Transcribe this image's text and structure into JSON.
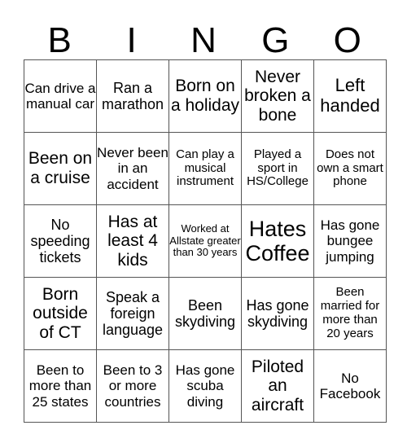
{
  "header": {
    "letters": [
      "B",
      "I",
      "N",
      "G",
      "O"
    ]
  },
  "rows": [
    [
      "Can drive a manual car",
      "Ran a marathon",
      "Born on a holiday",
      "Never broken a bone",
      "Left handed"
    ],
    [
      "Been on a cruise",
      "Never been in an accident",
      "Can play a musical instrument",
      "Played a sport in HS/College",
      "Does not own a smart phone"
    ],
    [
      "No speeding tickets",
      "Has at least 4 kids",
      "Worked at Allstate greater than 30 years",
      "Hates Coffee",
      "Has gone bungee jumping"
    ],
    [
      "Born outside of CT",
      "Speak a foreign language",
      "Been skydiving",
      "Has gone skydiving",
      "Been married for more than 20 years"
    ],
    [
      "Been to more than 25 states",
      "Been to 3 or more countries",
      "Has gone scuba diving",
      "Piloted an aircraft",
      "No Facebook"
    ]
  ]
}
